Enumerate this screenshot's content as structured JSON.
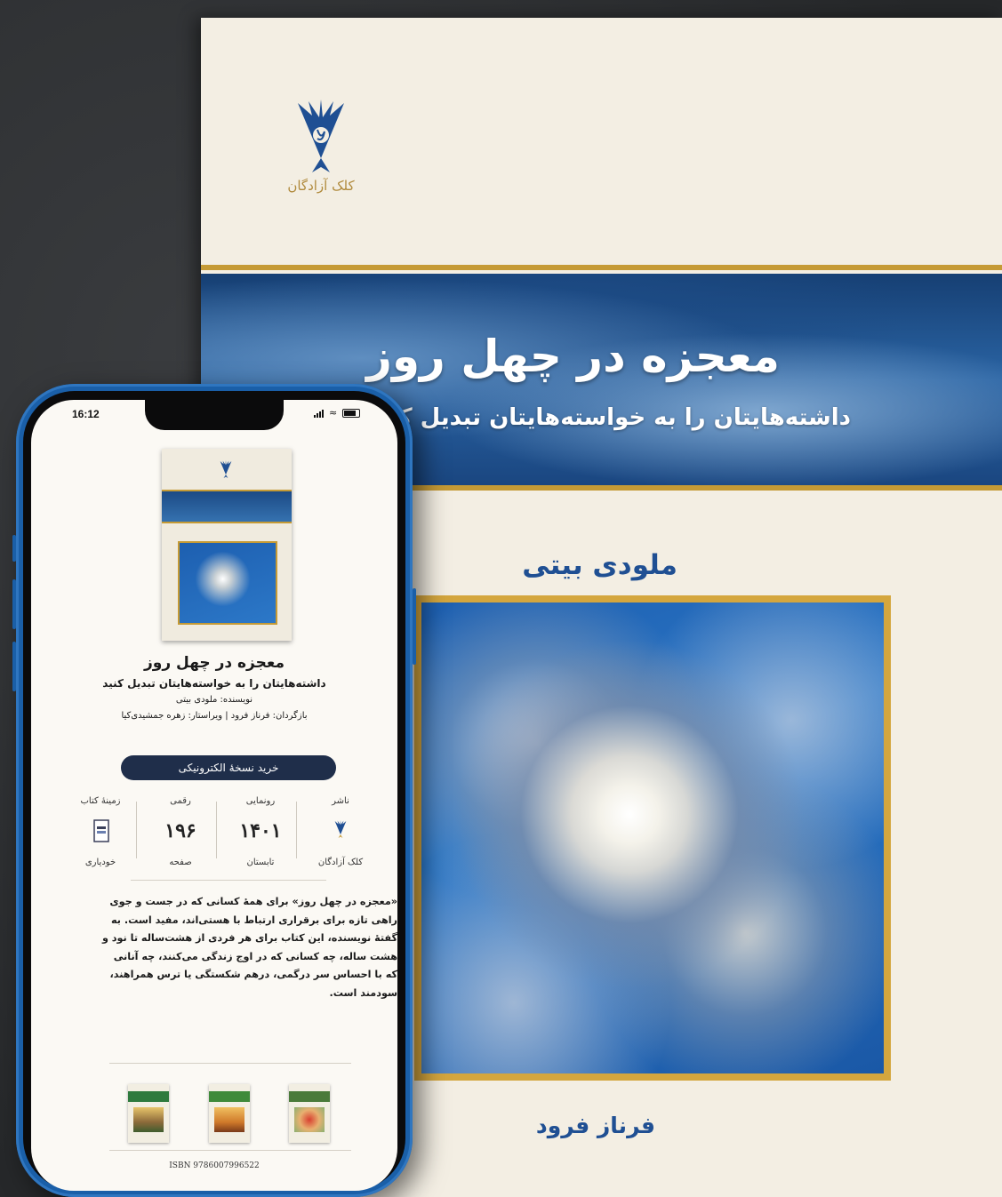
{
  "book_cover": {
    "publisher_logo_text": "کلک آزادگان",
    "title": "معجزه در چهل روز",
    "subtitle": "داشته‌هایتان را به خواسته‌هایتان تبدیل ک",
    "author": "ملودی بیتی",
    "translator": "فرناز فرود"
  },
  "status_bar": {
    "time": "16:12"
  },
  "product": {
    "title": "معجزه در چهل روز",
    "subtitle": "داشته‌هایتان را به خواسته‌هایتان تبدیل کنید",
    "author_line": "نویسنده: ملودی بیتی",
    "credits_line": "بازگردان: فرناز فرود | ویراستار: زهره جمشیدی‌کیا",
    "buy_button": "خرید نسخهٔ الکترونیکی"
  },
  "meta": [
    {
      "top": "ناشر",
      "value": "",
      "bottom": "کلک آزادگان",
      "icon": "publisher-logo-icon"
    },
    {
      "top": "رونمایی",
      "value": "۱۴۰۱",
      "bottom": "تابستان"
    },
    {
      "top": "رقمی",
      "value": "۱۹۶",
      "bottom": "صفحه"
    },
    {
      "top": "زمینهٔ کتاب",
      "value": "",
      "bottom": "خودیاری",
      "icon": "book-category-icon"
    }
  ],
  "description": [
    "«معجزه در چهل روز» برای همهٔ کسانی که در جست و جوی",
    "راهی تازه برای برقراری ارتباط با هستی‌اند، مفید است. به",
    "گفتهٔ نویسنده، این کتاب برای هر فردی از هشت‌ساله تا نود و",
    "هشت ساله، چه کسانی که در اوج زندگی می‌کنند، چه آنانی",
    "که با احساس سر درگمی، درهم شکستگی یا ترس همراهند،",
    "سودمند است."
  ],
  "isbn": "ISBN 9786007996522",
  "colors": {
    "accent_gold": "#c59a35",
    "title_blue": "#1f4f93",
    "button_navy": "#1f2e4a",
    "phone_frame_blue": "#1a5fa8"
  }
}
